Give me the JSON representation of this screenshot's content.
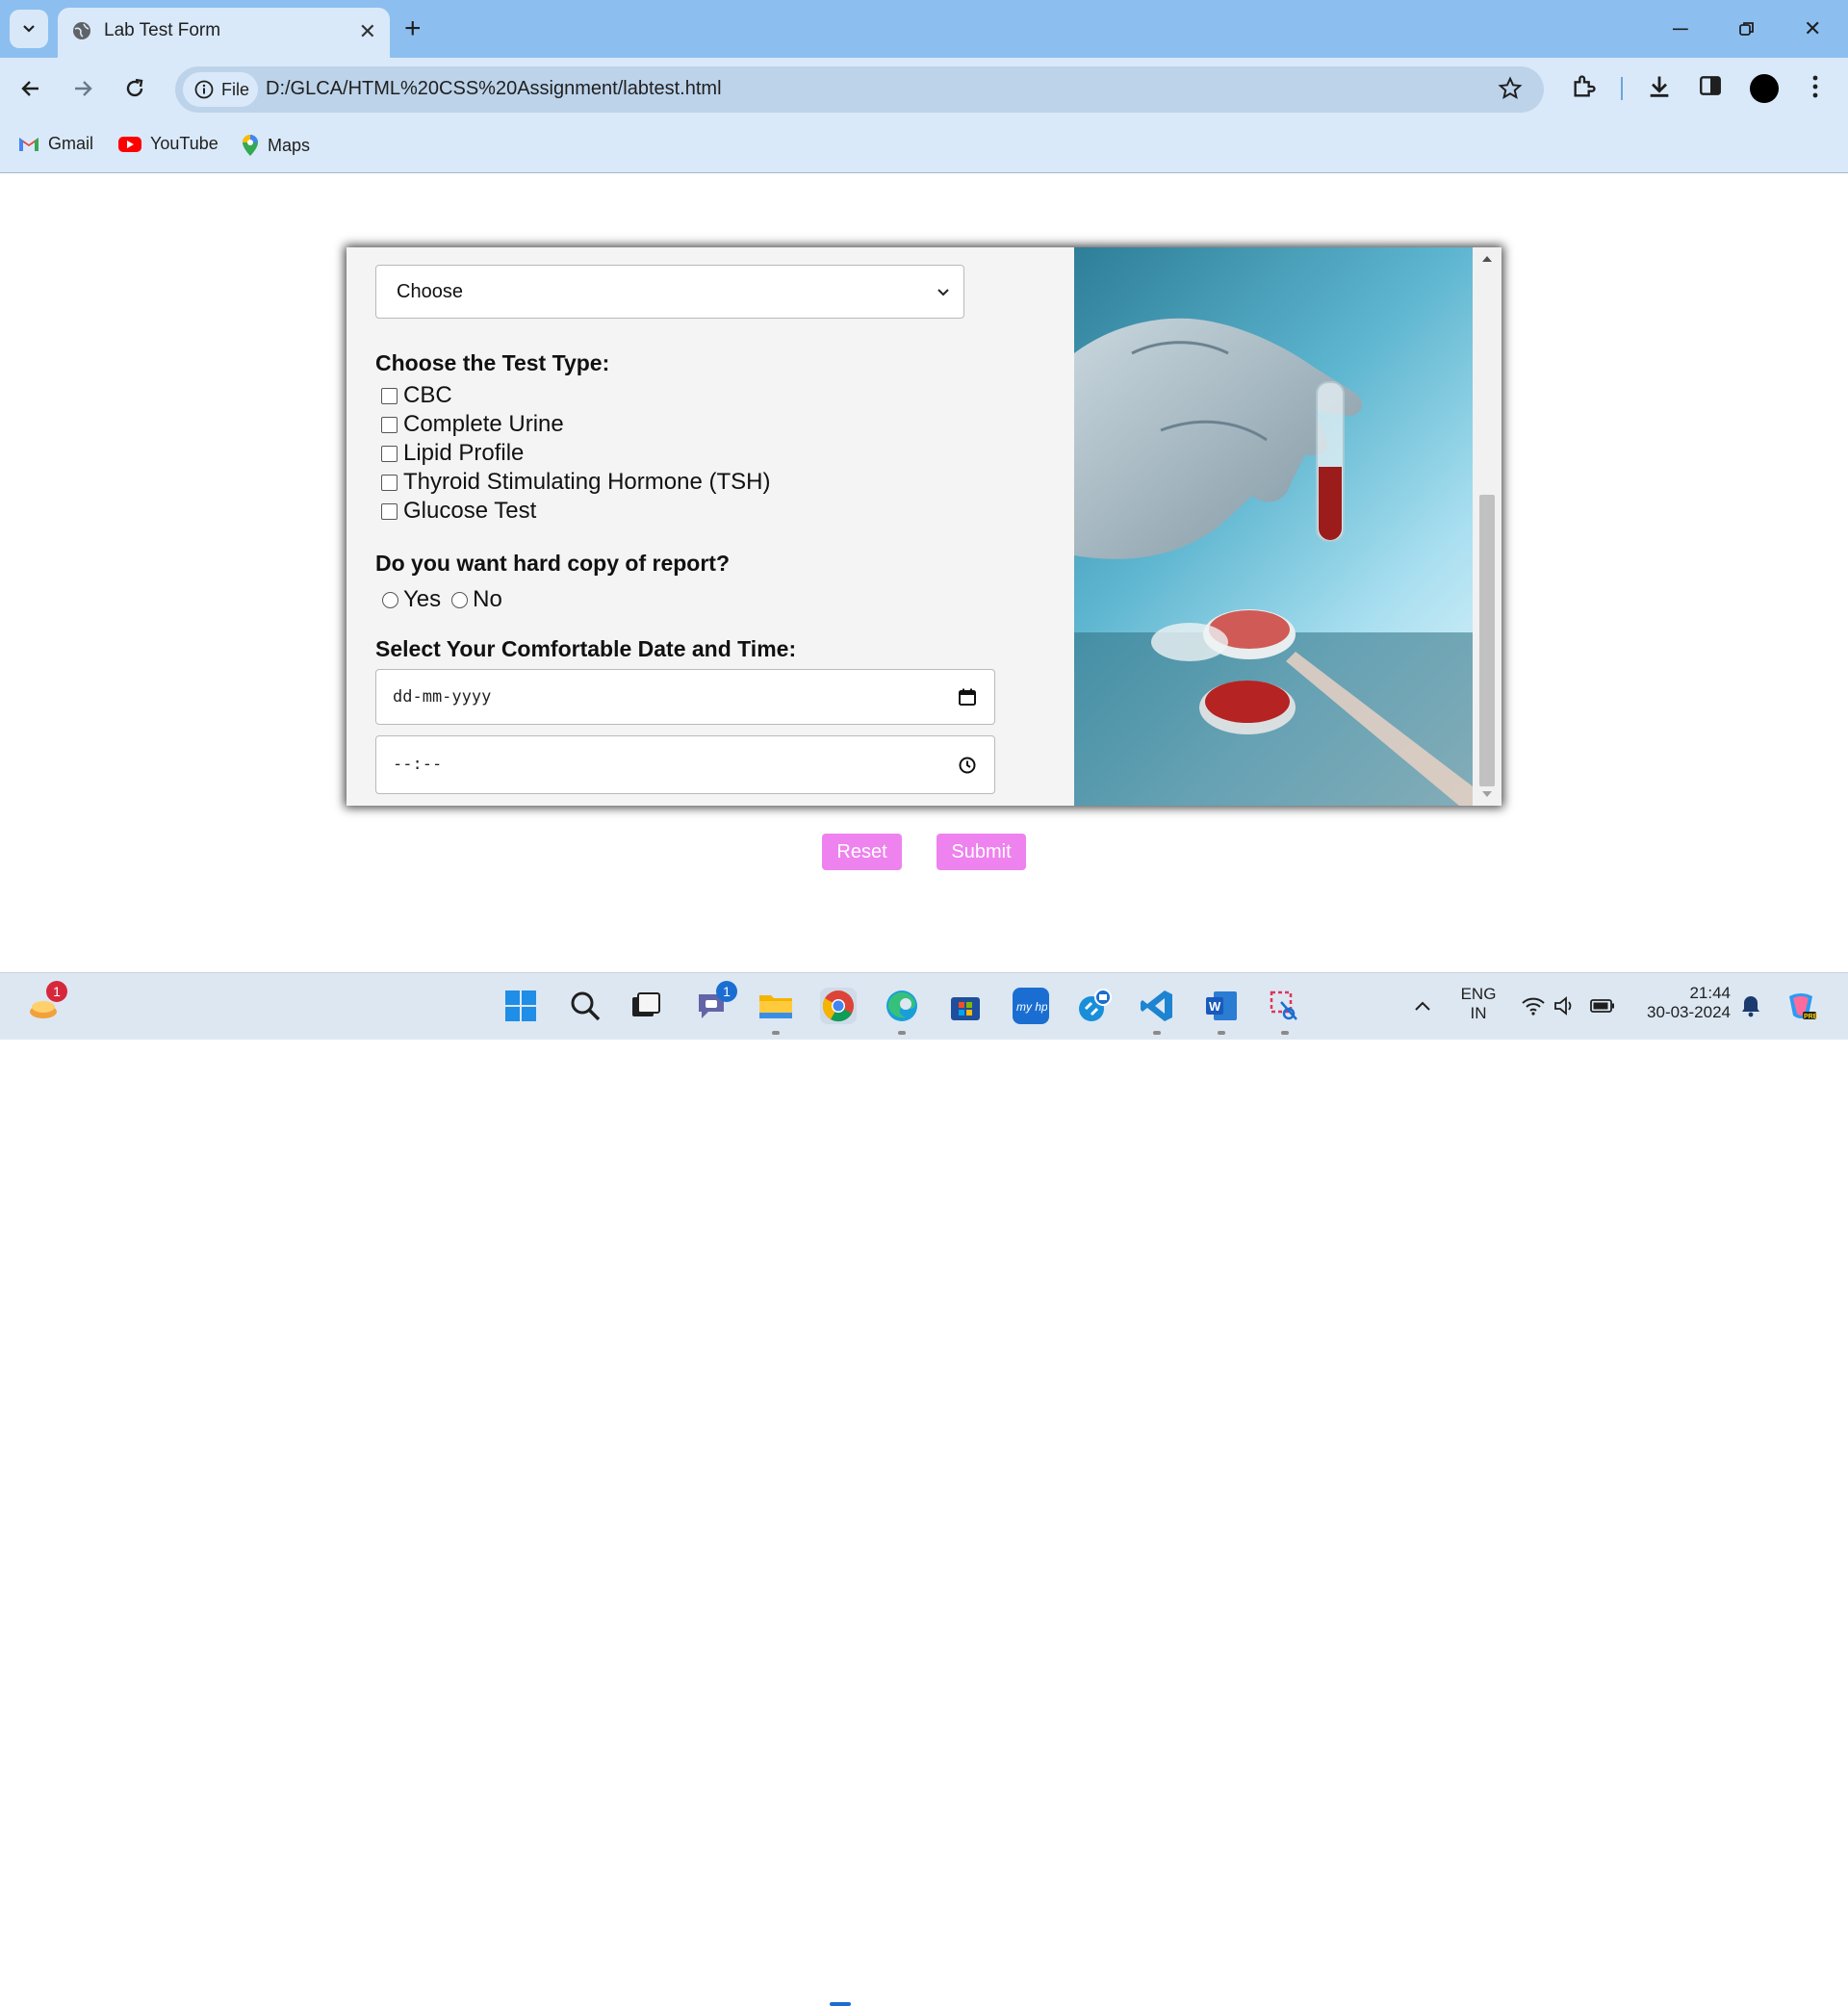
{
  "browser": {
    "tab_title": "Lab Test Form",
    "new_tab_symbol": "+",
    "site_chip_label": "File",
    "url": "D:/GLCA/HTML%20CSS%20Assignment/labtest.html",
    "bookmarks": [
      "Gmail",
      "YouTube",
      "Maps"
    ]
  },
  "form": {
    "select_value": "Choose",
    "test_type_heading": "Choose the Test Type:",
    "test_types": [
      "CBC",
      "Complete Urine",
      "Lipid Profile",
      "Thyroid Stimulating Hormone (TSH)",
      "Glucose Test"
    ],
    "hard_copy_heading": "Do you want hard copy of report?",
    "hard_copy_options": [
      "Yes",
      "No"
    ],
    "datetime_heading": "Select Your Comfortable Date and Time:",
    "date_placeholder": "dd-mm-yyyy",
    "time_placeholder": "--:--",
    "reset_label": "Reset",
    "submit_label": "Submit"
  },
  "taskbar": {
    "widget_badge": "1",
    "teams_badge": "1",
    "language_line1": "ENG",
    "language_line2": "IN",
    "time": "21:44",
    "date": "30-03-2024"
  },
  "colors": {
    "tabstrip": "#8cbff0",
    "toolbar": "#dae9f9",
    "button_pink": "#ee82ee"
  }
}
